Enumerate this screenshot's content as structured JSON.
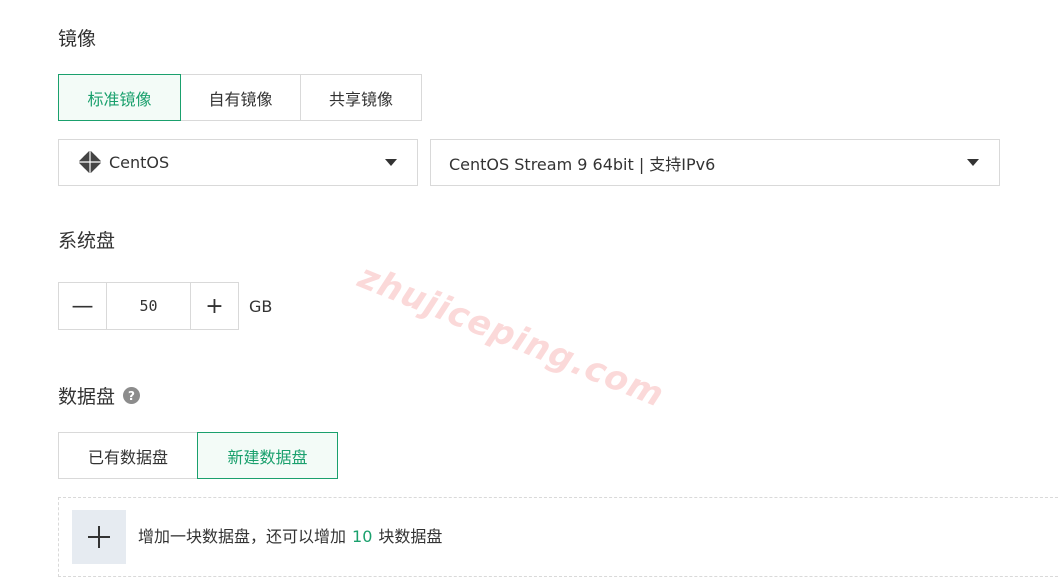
{
  "image_section": {
    "title": "镜像",
    "tabs": [
      {
        "label": "标准镜像",
        "active": true
      },
      {
        "label": "自有镜像",
        "active": false
      },
      {
        "label": "共享镜像",
        "active": false
      }
    ],
    "os_select": {
      "icon": "centos-logo-icon",
      "value": "CentOS"
    },
    "version_select": {
      "value": "CentOS Stream 9 64bit | 支持IPv6"
    }
  },
  "system_disk": {
    "title": "系统盘",
    "decrement_label": "—",
    "increment_label": "+",
    "value": "50",
    "unit": "GB"
  },
  "data_disk": {
    "title": "数据盘",
    "help_label": "?",
    "tabs": [
      {
        "label": "已有数据盘",
        "active": false
      },
      {
        "label": "新建数据盘",
        "active": true
      }
    ],
    "add_prefix": "增加一块数据盘，还可以增加",
    "add_count": "10",
    "add_suffix": "块数据盘"
  },
  "watermark": "zhujiceping.com",
  "colors": {
    "accent": "#1aa06d",
    "border": "#d9d9d9",
    "text": "#333333"
  }
}
